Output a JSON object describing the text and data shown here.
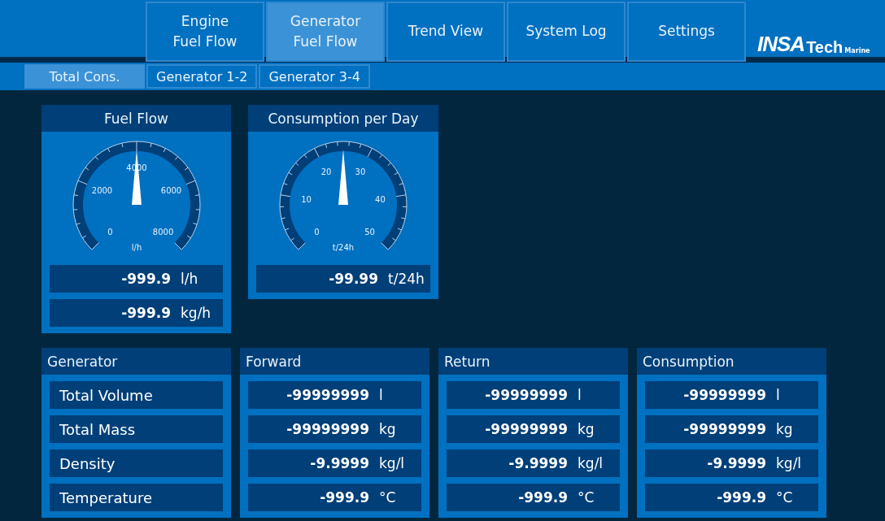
{
  "nav": {
    "tabs": [
      {
        "label": "Engine\nFuel Flow",
        "selected": false
      },
      {
        "label": "Generator\nFuel Flow",
        "selected": true
      },
      {
        "label": "Trend View",
        "selected": false
      },
      {
        "label": "System Log",
        "selected": false
      },
      {
        "label": "Settings",
        "selected": false
      }
    ],
    "logo": {
      "brand": "INSA",
      "name": "Tech",
      "suffix": "Marine"
    }
  },
  "subtabs": [
    {
      "label": "Total Cons.",
      "selected": true
    },
    {
      "label": "Generator 1-2",
      "selected": false
    },
    {
      "label": "Generator 3-4",
      "selected": false
    }
  ],
  "gauges": [
    {
      "title": "Fuel Flow",
      "scale": [
        "0",
        "2000",
        "4000",
        "6000",
        "8000"
      ],
      "unit": "l/h",
      "readings": [
        {
          "value": "-999.9",
          "unit": "l/h"
        },
        {
          "value": "-999.9",
          "unit": "kg/h"
        }
      ]
    },
    {
      "title": "Consumption per Day",
      "scale": [
        "0",
        "10",
        "20",
        "30",
        "40",
        "50"
      ],
      "unit": "t/24h",
      "readings": [
        {
          "value": "-99.99",
          "unit": "t/24h"
        }
      ]
    }
  ],
  "table": {
    "columns": [
      {
        "kind": "labels",
        "title": "Generator",
        "cells": [
          {
            "label": "Total Volume"
          },
          {
            "label": "Total Mass"
          },
          {
            "label": "Density"
          },
          {
            "label": "Temperature"
          }
        ]
      },
      {
        "kind": "values",
        "title": "Forward",
        "cells": [
          {
            "value": "-99999999",
            "unit": "l"
          },
          {
            "value": "-99999999",
            "unit": "kg"
          },
          {
            "value": "-9.9999",
            "unit": "kg/l"
          },
          {
            "value": "-999.9",
            "unit": "°C"
          }
        ]
      },
      {
        "kind": "values",
        "title": "Return",
        "cells": [
          {
            "value": "-99999999",
            "unit": "l"
          },
          {
            "value": "-99999999",
            "unit": "kg"
          },
          {
            "value": "-9.9999",
            "unit": "kg/l"
          },
          {
            "value": "-999.9",
            "unit": "°C"
          }
        ]
      },
      {
        "kind": "values",
        "title": "Consumption",
        "cells": [
          {
            "value": "-99999999",
            "unit": "l"
          },
          {
            "value": "-99999999",
            "unit": "kg"
          },
          {
            "value": "-9.9999",
            "unit": "kg/l"
          },
          {
            "value": "-999.9",
            "unit": "°C"
          }
        ]
      }
    ]
  }
}
